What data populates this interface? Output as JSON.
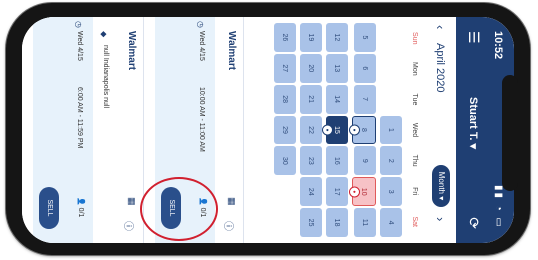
{
  "status": {
    "time": "10:52",
    "indicators": "▮▮ ◔ ▭"
  },
  "header": {
    "menu_icon": "menu-icon",
    "user": "Stuart T.",
    "refresh_icon": "refresh-icon"
  },
  "calendar": {
    "month": "April 2020",
    "view_button": "Month",
    "weekdays": [
      "Sun",
      "Mon",
      "Tue",
      "Wed",
      "Thu",
      "Fri",
      "Sat"
    ],
    "weeks": [
      [
        "",
        "",
        "",
        "1",
        "2",
        "3",
        "4"
      ],
      [
        "5",
        "6",
        "7",
        "8",
        "9",
        "10",
        "11"
      ],
      [
        "12",
        "13",
        "14",
        "15",
        "16",
        "17",
        "18"
      ],
      [
        "19",
        "20",
        "21",
        "22",
        "23",
        "24",
        "25"
      ],
      [
        "26",
        "27",
        "28",
        "29",
        "30",
        "",
        ""
      ]
    ],
    "selected_day": "15",
    "today": "10",
    "outlined_day": "8"
  },
  "stores": [
    {
      "name": "Walmart",
      "info_icon": "info-icon",
      "shift": {
        "date": "Wed 4/15",
        "time": "10:00 AM - 11:00 AM",
        "user_count": "0/1",
        "button": "SELL"
      }
    },
    {
      "name": "Walmart",
      "info_icon": "info-icon",
      "shift": {
        "date": "Wed 4/15",
        "time": "6:00 AM - 11:59 PM",
        "user_count": "0/1",
        "button": "SELL",
        "location": "null Indianapolis null"
      }
    }
  ],
  "colors": {
    "brand": "#1f3f73",
    "day": "#a9c2e8",
    "today": "#f7c2c6",
    "highlight": "#d1202f"
  }
}
